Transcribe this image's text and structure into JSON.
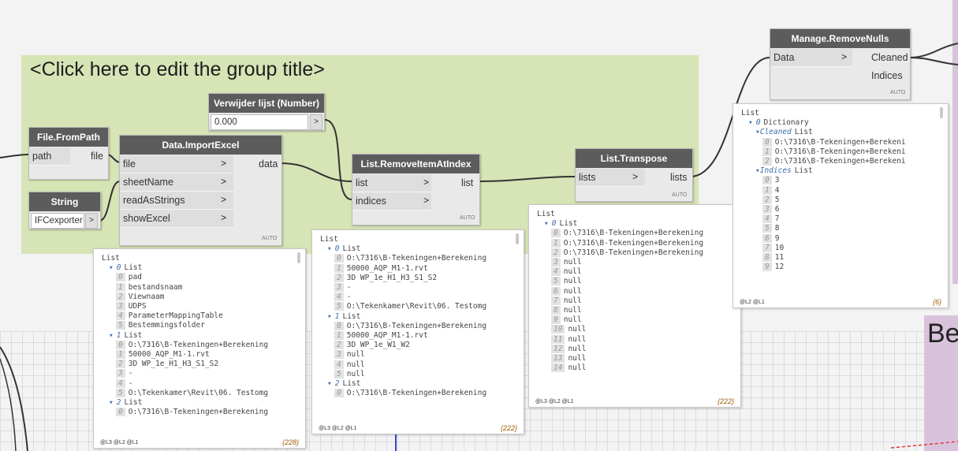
{
  "group": {
    "title": "<Click here to edit the group title>",
    "right_text": "Be"
  },
  "nodes": {
    "file_from_path": {
      "title": "File.FromPath",
      "in_port": "path",
      "out_port": "file"
    },
    "string": {
      "title": "String",
      "value": "IFCexporter",
      "out": ">"
    },
    "import_excel": {
      "title": "Data.ImportExcel",
      "inputs": [
        "file",
        "sheetName",
        "readAsStrings",
        "showExcel"
      ],
      "output": "data",
      "auto": "AUTO"
    },
    "number": {
      "title": "Verwijder lijst (Number)",
      "value": "0.000",
      "out": ">"
    },
    "remove_item": {
      "title": "List.RemoveItemAtIndex",
      "inputs": [
        "list",
        "indices"
      ],
      "output": "list",
      "auto": "AUTO"
    },
    "transpose": {
      "title": "List.Transpose",
      "input": "lists",
      "output": "lists",
      "auto": "AUTO"
    },
    "remove_nulls": {
      "title": "Manage.RemoveNulls",
      "input": "Data",
      "outputs": [
        "Cleaned",
        "Indices"
      ],
      "auto": "AUTO"
    }
  },
  "arrow_glyph": ">",
  "watches": {
    "w1": {
      "levels": "@L3 @L2 @L1",
      "count": "{228}",
      "lines": [
        {
          "d": 0,
          "t": "List"
        },
        {
          "d": 1,
          "k": "List",
          "idx": "0"
        },
        {
          "d": 2,
          "idx": "0",
          "t": "pad"
        },
        {
          "d": 2,
          "idx": "1",
          "t": "bestandsnaam"
        },
        {
          "d": 2,
          "idx": "2",
          "t": "Viewnaam"
        },
        {
          "d": 2,
          "idx": "3",
          "t": "UDPS"
        },
        {
          "d": 2,
          "idx": "4",
          "t": "ParameterMappingTable"
        },
        {
          "d": 2,
          "idx": "5",
          "t": "Bestemmingsfolder"
        },
        {
          "d": 1,
          "k": "List",
          "idx": "1"
        },
        {
          "d": 2,
          "idx": "0",
          "t": "O:\\7316\\B-Tekeningen+Berekening"
        },
        {
          "d": 2,
          "idx": "1",
          "t": "50000_AQP_M1-1.rvt"
        },
        {
          "d": 2,
          "idx": "2",
          "t": "3D WP_1e_H1_H3_S1_S2"
        },
        {
          "d": 2,
          "idx": "3",
          "t": "-"
        },
        {
          "d": 2,
          "idx": "4",
          "t": "-"
        },
        {
          "d": 2,
          "idx": "5",
          "t": "O:\\Tekenkamer\\Revit\\06. Testomg"
        },
        {
          "d": 1,
          "k": "List",
          "idx": "2"
        },
        {
          "d": 2,
          "idx": "0",
          "t": "O:\\7316\\B-Tekeningen+Berekening"
        }
      ]
    },
    "w2": {
      "levels": "@L3 @L2 @L1",
      "count": "{222}",
      "lines": [
        {
          "d": 0,
          "t": "List"
        },
        {
          "d": 1,
          "k": "List",
          "idx": "0"
        },
        {
          "d": 2,
          "idx": "0",
          "t": "O:\\7316\\B-Tekeningen+Berekening"
        },
        {
          "d": 2,
          "idx": "1",
          "t": "50000_AQP_M1-1.rvt"
        },
        {
          "d": 2,
          "idx": "2",
          "t": "3D WP_1e_H1_H3_S1_S2"
        },
        {
          "d": 2,
          "idx": "3",
          "t": "-"
        },
        {
          "d": 2,
          "idx": "4",
          "t": "-"
        },
        {
          "d": 2,
          "idx": "5",
          "t": "O:\\Tekenkamer\\Revit\\06. Testomg"
        },
        {
          "d": 1,
          "k": "List",
          "idx": "1"
        },
        {
          "d": 2,
          "idx": "0",
          "t": "O:\\7316\\B-Tekeningen+Berekening"
        },
        {
          "d": 2,
          "idx": "1",
          "t": "50000_AQP_M1-1.rvt"
        },
        {
          "d": 2,
          "idx": "2",
          "t": "3D WP_1e_W1_W2"
        },
        {
          "d": 2,
          "idx": "3",
          "t": "null"
        },
        {
          "d": 2,
          "idx": "4",
          "t": "null"
        },
        {
          "d": 2,
          "idx": "5",
          "t": "null"
        },
        {
          "d": 1,
          "k": "List",
          "idx": "2"
        },
        {
          "d": 2,
          "idx": "0",
          "t": "O:\\7316\\B-Tekeningen+Berekening"
        }
      ]
    },
    "w3": {
      "levels": "@L3 @L2 @L1",
      "count": "{222}",
      "lines": [
        {
          "d": 0,
          "t": "List"
        },
        {
          "d": 1,
          "k": "List",
          "idx": "0"
        },
        {
          "d": 2,
          "idx": "0",
          "t": "O:\\7316\\B-Tekeningen+Berekening"
        },
        {
          "d": 2,
          "idx": "1",
          "t": "O:\\7316\\B-Tekeningen+Berekening"
        },
        {
          "d": 2,
          "idx": "2",
          "t": "O:\\7316\\B-Tekeningen+Berekening"
        },
        {
          "d": 2,
          "idx": "3",
          "t": "null"
        },
        {
          "d": 2,
          "idx": "4",
          "t": "null"
        },
        {
          "d": 2,
          "idx": "5",
          "t": "null"
        },
        {
          "d": 2,
          "idx": "6",
          "t": "null"
        },
        {
          "d": 2,
          "idx": "7",
          "t": "null"
        },
        {
          "d": 2,
          "idx": "8",
          "t": "null"
        },
        {
          "d": 2,
          "idx": "9",
          "t": "null"
        },
        {
          "d": 2,
          "idx": "10",
          "t": "null"
        },
        {
          "d": 2,
          "idx": "11",
          "t": "null"
        },
        {
          "d": 2,
          "idx": "12",
          "t": "null"
        },
        {
          "d": 2,
          "idx": "13",
          "t": "null"
        },
        {
          "d": 2,
          "idx": "14",
          "t": "null"
        }
      ]
    },
    "w4": {
      "levels": "@L2 @L1",
      "count": "{6}",
      "lines": [
        {
          "d": 0,
          "t": "List"
        },
        {
          "d": 1,
          "k": "Dictionary",
          "idx": "0"
        },
        {
          "d": 2,
          "k": "List",
          "lbl": "Cleaned"
        },
        {
          "d": 3,
          "idx": "0",
          "t": "O:\\7316\\B-Tekeningen+Berekeni"
        },
        {
          "d": 3,
          "idx": "1",
          "t": "O:\\7316\\B-Tekeningen+Berekeni"
        },
        {
          "d": 3,
          "idx": "2",
          "t": "O:\\7316\\B-Tekeningen+Berekeni"
        },
        {
          "d": 2,
          "k": "List",
          "lbl": "Indices"
        },
        {
          "d": 3,
          "idx": "0",
          "t": "3"
        },
        {
          "d": 3,
          "idx": "1",
          "t": "4"
        },
        {
          "d": 3,
          "idx": "2",
          "t": "5"
        },
        {
          "d": 3,
          "idx": "3",
          "t": "6"
        },
        {
          "d": 3,
          "idx": "4",
          "t": "7"
        },
        {
          "d": 3,
          "idx": "5",
          "t": "8"
        },
        {
          "d": 3,
          "idx": "6",
          "t": "9"
        },
        {
          "d": 3,
          "idx": "7",
          "t": "10"
        },
        {
          "d": 3,
          "idx": "8",
          "t": "11"
        },
        {
          "d": 3,
          "idx": "9",
          "t": "12"
        }
      ]
    }
  },
  "colors": {
    "group_green": "#d7e4b6",
    "group_purple": "#d9c2dc",
    "node_header": "#5c5c5c",
    "wire": "#333333",
    "count": "#a05a00"
  }
}
